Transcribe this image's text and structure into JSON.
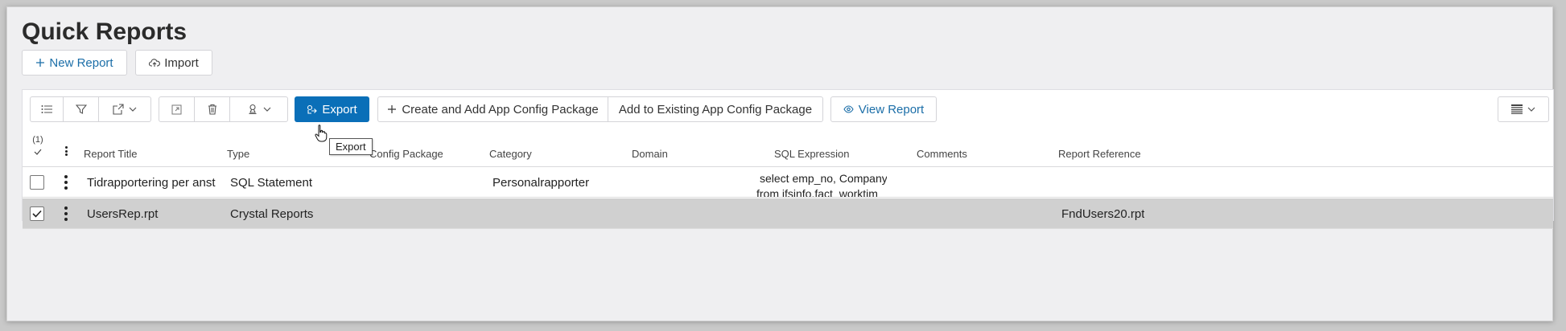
{
  "page": {
    "title": "Quick Reports"
  },
  "top_actions": {
    "new_report": "New Report",
    "import": "Import"
  },
  "toolbar": {
    "export_label": "Export",
    "export_tooltip": "Export",
    "create_and_add": "Create and Add App Config Package",
    "add_to_existing": "Add to Existing App Config Package",
    "view_report": "View Report"
  },
  "table": {
    "selection_count": "(1)",
    "columns": [
      "Report Title",
      "Type",
      "Config Package",
      "Category",
      "Domain",
      "SQL Expression",
      "Comments",
      "Report Reference"
    ],
    "rows": [
      {
        "selected": false,
        "title": "Tidrapportering per anst",
        "type": "SQL Statement",
        "category": "Personalrapporter",
        "domain": "",
        "sql_line1": "select emp_no, Company",
        "sql_line2": "from ifsinfo.fact_worktim",
        "comments": "",
        "reference": ""
      },
      {
        "selected": true,
        "title": "UsersRep.rpt",
        "type": "Crystal Reports",
        "category": "",
        "domain": "",
        "sql_line1": "",
        "sql_line2": "",
        "comments": "",
        "reference": "FndUsers20.rpt"
      }
    ]
  },
  "colors": {
    "accent": "#0a6fb8",
    "selected_row": "#d0d0d0"
  }
}
